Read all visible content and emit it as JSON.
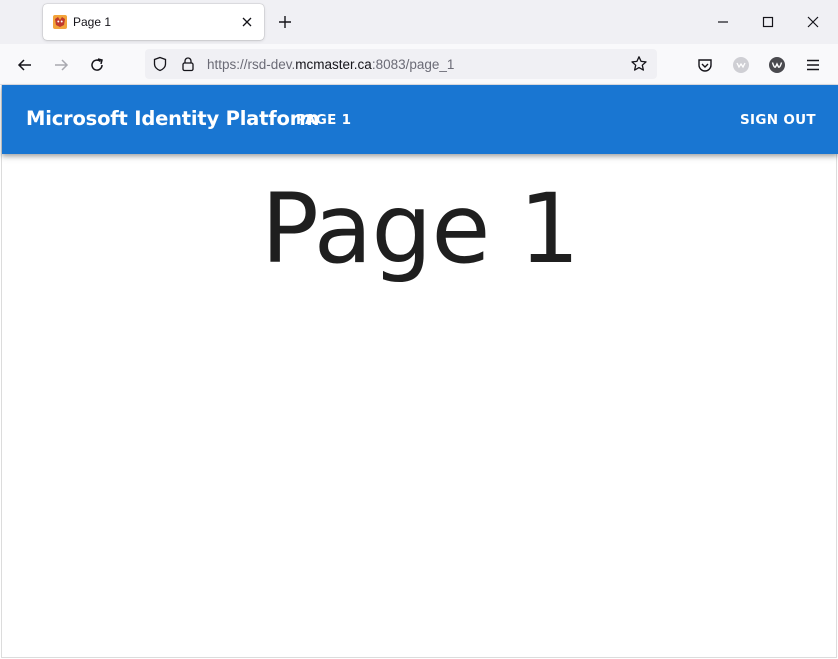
{
  "browser": {
    "tab": {
      "title": "Page 1",
      "favicon": "app-favicon-icon"
    },
    "url": {
      "prefix": "https://rsd-dev.",
      "host": "mcmaster.ca",
      "suffix": ":8083/page_1"
    }
  },
  "app": {
    "title": "Microsoft Identity Platform",
    "nav": {
      "page1_label": "PAGE 1",
      "signout_label": "SIGN OUT"
    },
    "accent_color": "#1976d2"
  },
  "main": {
    "heading": "Page 1"
  }
}
